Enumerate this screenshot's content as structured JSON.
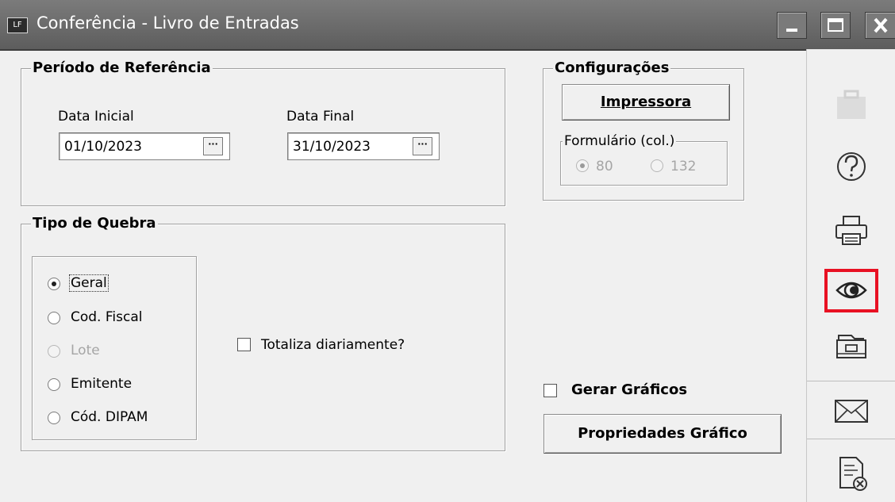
{
  "window": {
    "title": "Conferência - Livro de Entradas",
    "app_icon_text": "LF"
  },
  "periodo": {
    "legend": "Período de Referência",
    "data_inicial_label": "Data Inicial",
    "data_inicial_value": "01/10/2023",
    "data_final_label": "Data Final",
    "data_final_value": "31/10/2023",
    "picker_label": "···"
  },
  "configuracoes": {
    "legend": "Configurações",
    "impressora_label": "Impressora",
    "formulario_legend": "Formulário (col.)",
    "options": [
      {
        "label": "80",
        "selected": true,
        "enabled": false
      },
      {
        "label": "132",
        "selected": false,
        "enabled": false
      }
    ]
  },
  "quebra": {
    "legend": "Tipo de Quebra",
    "options": [
      {
        "label": "Geral",
        "selected": true,
        "enabled": true
      },
      {
        "label": "Cod. Fiscal",
        "selected": false,
        "enabled": true
      },
      {
        "label": "Lote",
        "selected": false,
        "enabled": false
      },
      {
        "label": "Emitente",
        "selected": false,
        "enabled": true
      },
      {
        "label": "Cód. DIPAM",
        "selected": false,
        "enabled": true
      }
    ],
    "totaliza_label": "Totaliza diariamente?",
    "totaliza_checked": false
  },
  "graficos": {
    "gerar_label": "Gerar Gráficos",
    "gerar_checked": false,
    "propriedades_label": "Propriedades Gráfico"
  },
  "toolbar": {
    "items": [
      "briefcase-icon",
      "help-icon",
      "print-icon",
      "preview-eye-icon",
      "archive-icon",
      "email-icon",
      "close-document-icon"
    ],
    "highlight_color": "#e81123"
  }
}
